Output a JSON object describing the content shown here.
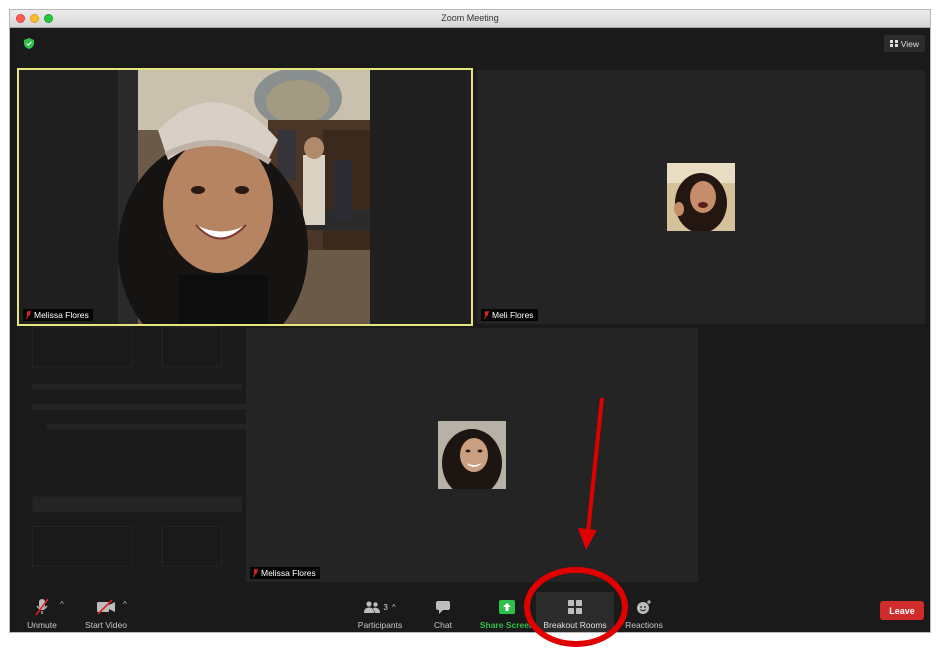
{
  "window": {
    "title": "Zoom Meeting"
  },
  "topbar": {
    "view_label": "View"
  },
  "participants_tiles": [
    {
      "name": "Melissa Flores",
      "active_speaker": true
    },
    {
      "name": "Meli Flores",
      "active_speaker": false
    },
    {
      "name": "Melissa Flores",
      "active_speaker": false
    }
  ],
  "toolbar": {
    "unmute_label": "Unmute",
    "start_video_label": "Start Video",
    "participants_label": "Participants",
    "participants_count": "3",
    "chat_label": "Chat",
    "share_screen_label": "Share Screen",
    "breakout_rooms_label": "Breakout Rooms",
    "reactions_label": "Reactions",
    "leave_label": "Leave"
  },
  "colors": {
    "active_border": "#e6e67a",
    "share_green": "#2fbf4a",
    "leave_red": "#d12c2c",
    "annotation_red": "#e00000",
    "muted_red": "#e02020"
  },
  "icons": [
    "shield-icon",
    "grid-icon",
    "mic-muted-icon",
    "video-off-icon",
    "participants-icon",
    "chat-icon",
    "share-screen-icon",
    "breakout-rooms-icon",
    "reactions-icon"
  ]
}
